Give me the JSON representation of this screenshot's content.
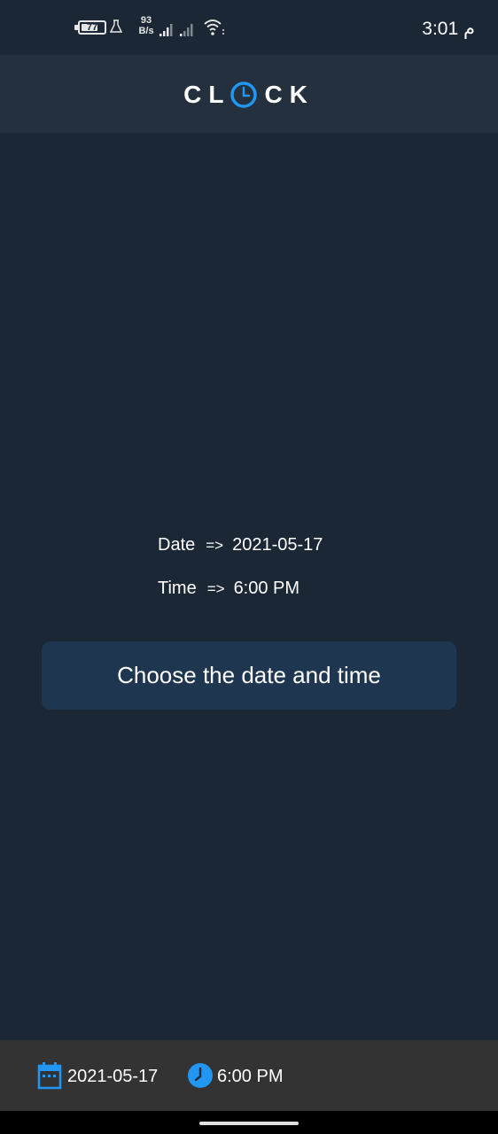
{
  "status_bar": {
    "battery_level": "77",
    "battery_fraction": 0.77,
    "net_speed_value": "93",
    "net_speed_unit": "B/s",
    "time": "3:01 م"
  },
  "app_bar": {
    "title_left": "CL",
    "title_right": "CK",
    "logo_icon": "clock-icon"
  },
  "info": {
    "date_label": "Date",
    "date_arrow": "=>",
    "date_value": "2021-05-17",
    "time_label": "Time",
    "time_arrow": "=>",
    "time_value": "6:00 PM"
  },
  "button": {
    "label": "Choose the date and time"
  },
  "bottom_bar": {
    "date_icon": "calendar-icon",
    "date_value": "2021-05-17",
    "time_icon": "clock-icon",
    "time_value": "6:00 PM"
  },
  "colors": {
    "background": "#1b2735",
    "app_bar": "#24303d",
    "button": "#1f3650",
    "accent": "#2196f3",
    "bottom_bar": "#333333"
  }
}
